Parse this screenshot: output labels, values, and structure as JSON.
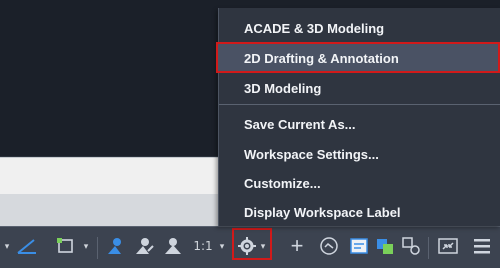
{
  "workspace_menu": {
    "items": [
      {
        "label": "ACADE & 3D Modeling",
        "selected": false
      },
      {
        "label": "2D Drafting & Annotation",
        "selected": true
      },
      {
        "label": "3D Modeling",
        "selected": false
      },
      {
        "label": "Save Current As...",
        "selected": false
      },
      {
        "label": "Workspace Settings...",
        "selected": false
      },
      {
        "label": "Customize...",
        "selected": false
      },
      {
        "label": "Display Workspace Label",
        "selected": false
      }
    ]
  },
  "status_bar": {
    "annotation_scale": "1:1",
    "icons": [
      "dropdown-arrow",
      "isodraft-icon",
      "dropdown-arrow",
      "annotation-visibility-icon",
      "autoscale-icon",
      "annotation-scale-icon",
      "dropdown-arrow",
      "workspace-gear-icon",
      "dropdown-arrow",
      "plus-icon",
      "isolate-objects-icon",
      "quick-properties-icon",
      "hardware-acceleration-icon",
      "clean-screen-icon",
      "customization-icon"
    ]
  },
  "colors": {
    "menu_background": "#2f3540",
    "status_bar_background": "#3c4350",
    "highlight_red": "#d11a1a",
    "accent_blue": "#3a8ee6"
  }
}
